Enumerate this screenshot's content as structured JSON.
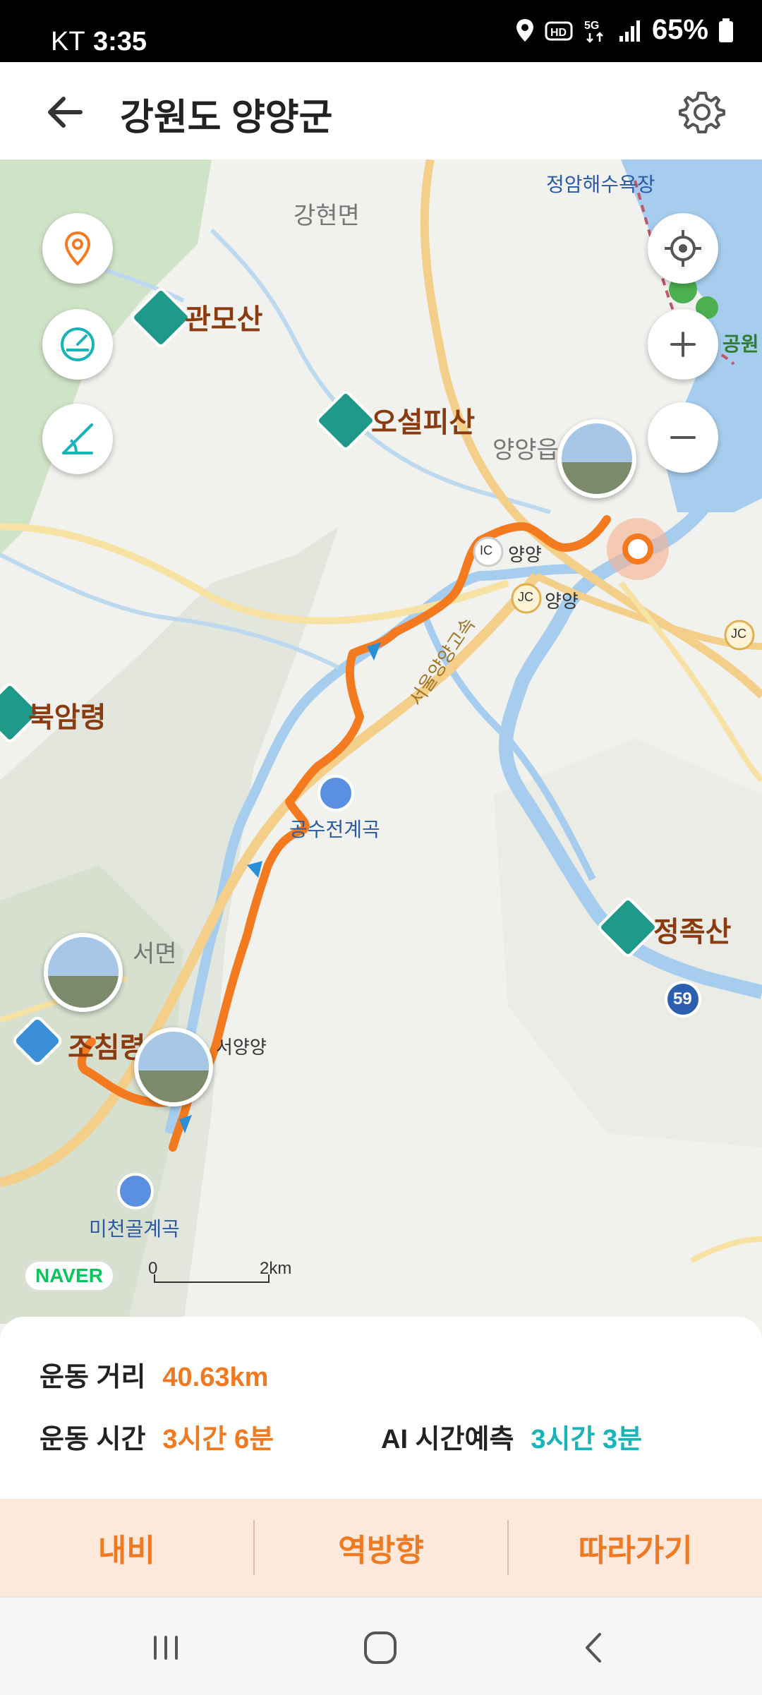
{
  "status_bar": {
    "carrier": "KT",
    "time": "3:35",
    "battery": "65%"
  },
  "header": {
    "title": "강원도 양양군"
  },
  "map": {
    "labels": {
      "ganghyeon": "강현면",
      "jeongam_beach": "정암해수욕장",
      "gwanmosan": "관모산",
      "oseolpisan": "오설피산",
      "yangyang_eup": "양양읍",
      "ic_yangyang": "양양",
      "jc_yangyang": "양양",
      "bugamryeong": "북암령",
      "expressway": "서울양양고속",
      "gongsujeon": "공수전계곡",
      "seomyeon": "서면",
      "jeongjoksan": "정족산",
      "jochimryeong": "조침령",
      "seoyangyang": "서양양",
      "micheongol": "미천골계곡",
      "park_fragment": "공원",
      "ic_badge": "IC",
      "jc_badge": "JC",
      "route_59": "59"
    },
    "naver_logo": "NAVER",
    "scale": {
      "start": "0",
      "end": "2km"
    },
    "colors": {
      "route": "#f47a20",
      "water": "#a6cdee",
      "forest": "#cfe4c6"
    }
  },
  "stats": {
    "distance_label": "운동 거리",
    "distance_value": "40.63km",
    "time_label": "운동 시간",
    "time_value": "3시간 6분",
    "ai_label": "AI 시간예측",
    "ai_value": "3시간 3분"
  },
  "actions": {
    "navi": "내비",
    "reverse": "역방향",
    "follow": "따라가기"
  }
}
